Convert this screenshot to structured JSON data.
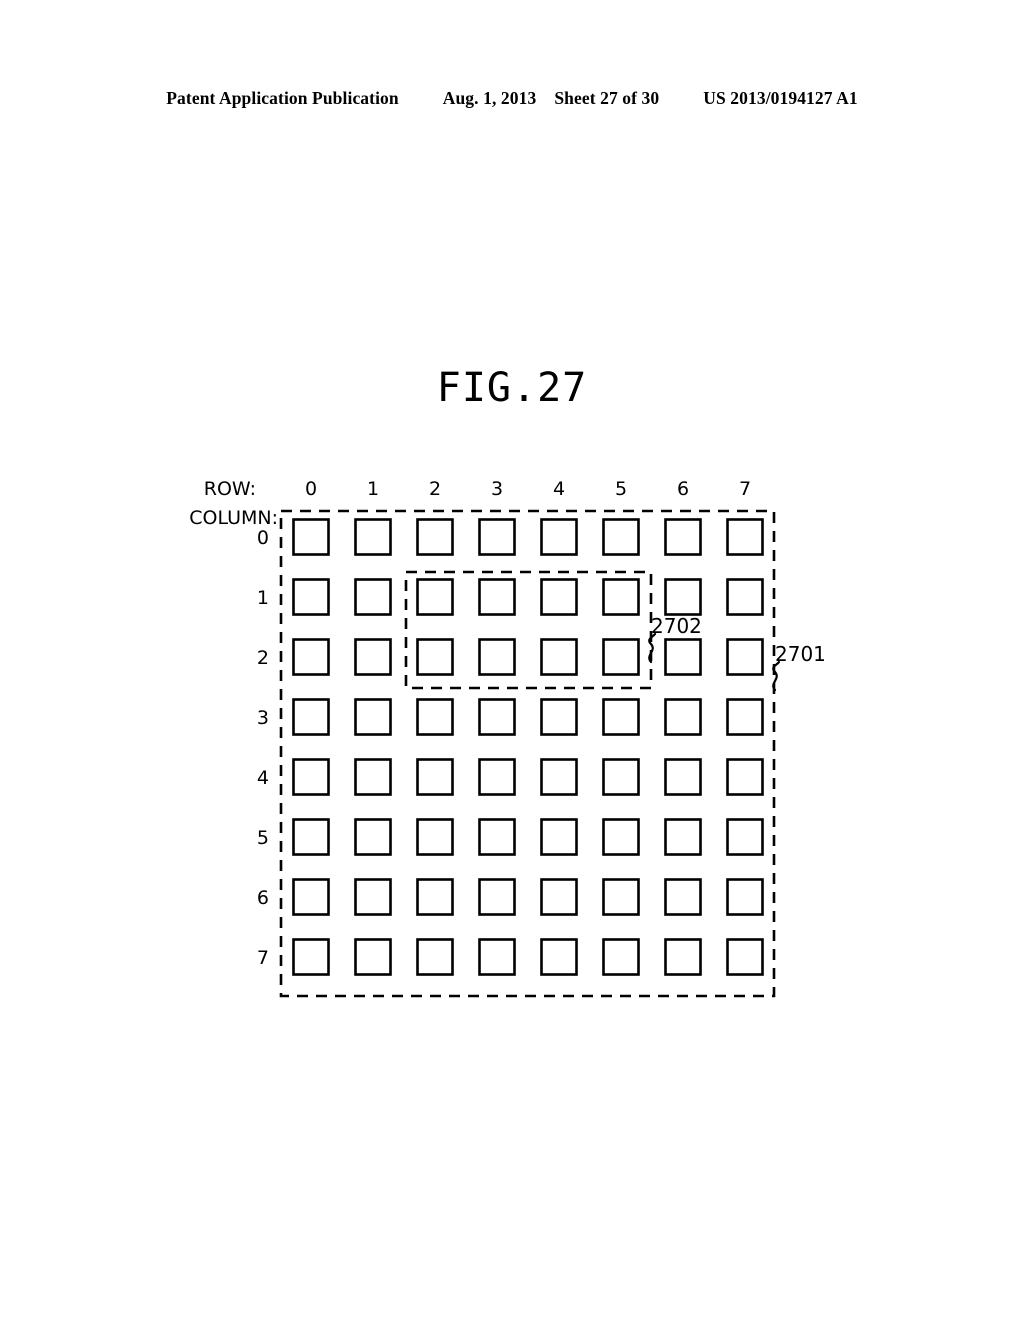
{
  "header": {
    "publication": "Patent Application Publication",
    "date": "Aug. 1, 2013",
    "sheet": "Sheet 27 of 30",
    "document_number": "US 2013/0194127 A1"
  },
  "figure": {
    "title": "FIG.27",
    "row_axis_label": "ROW:",
    "column_axis_label": "COLUMN:",
    "row_indices": [
      "0",
      "1",
      "2",
      "3",
      "4",
      "5",
      "6",
      "7"
    ],
    "column_indices": [
      "0",
      "1",
      "2",
      "3",
      "4",
      "5",
      "6",
      "7"
    ],
    "outer_region_ref": "2701",
    "inner_region_ref": "2702",
    "grid": {
      "rows": 8,
      "columns": 8,
      "cell_label": "block"
    },
    "inner_region": {
      "row_start": 2,
      "row_end": 5,
      "column_start": 1,
      "column_end": 2
    },
    "colors": {
      "ink": "#000000",
      "background": "#ffffff"
    }
  }
}
